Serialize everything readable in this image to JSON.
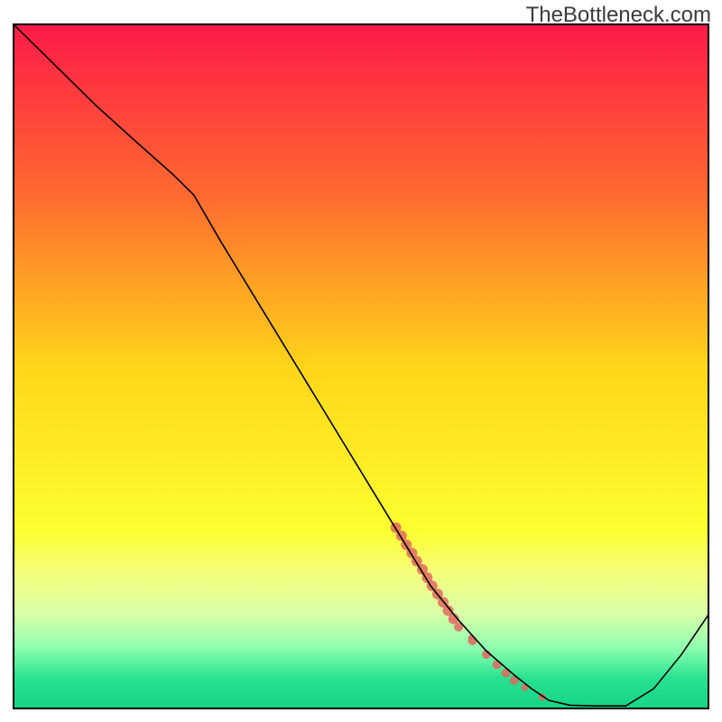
{
  "watermark_text": "TheBottleneck.com",
  "chart_data": {
    "type": "line",
    "title": "",
    "xlabel": "",
    "ylabel": "",
    "xlim": [
      0,
      100
    ],
    "ylim": [
      0,
      100
    ],
    "grid": false,
    "background_gradient_stops": [
      {
        "offset": 0.0,
        "color": "#ff1a48"
      },
      {
        "offset": 0.25,
        "color": "#ff6a30"
      },
      {
        "offset": 0.5,
        "color": "#ffd519"
      },
      {
        "offset": 0.74,
        "color": "#fcff2f"
      },
      {
        "offset": 0.8,
        "color": "#f5ff7a"
      },
      {
        "offset": 0.86,
        "color": "#d9ffa8"
      },
      {
        "offset": 0.91,
        "color": "#8effaf"
      },
      {
        "offset": 0.955,
        "color": "#27e290"
      },
      {
        "offset": 1.0,
        "color": "#14d484"
      }
    ],
    "series": [
      {
        "name": "bottleneck-curve",
        "color": "#000000",
        "width": 1.6,
        "x": [
          0,
          6,
          12,
          18,
          23,
          26,
          30,
          36,
          42,
          48,
          54,
          60,
          64,
          68,
          72,
          74.5,
          77,
          80,
          84,
          88,
          92,
          96,
          100
        ],
        "y": [
          100,
          94,
          88,
          82.5,
          78,
          75,
          68,
          58,
          48,
          38,
          28,
          18,
          13,
          8.5,
          5,
          3,
          1.3,
          0.6,
          0.5,
          0.5,
          3,
          8,
          14
        ]
      }
    ],
    "scatter_clusters": [
      {
        "name": "marker-cluster",
        "color": "#e0695f",
        "opacity": 0.85,
        "points": [
          {
            "x": 55.0,
            "y": 26.5,
            "r": 6
          },
          {
            "x": 55.8,
            "y": 25.3,
            "r": 6
          },
          {
            "x": 56.5,
            "y": 24.0,
            "r": 6
          },
          {
            "x": 57.3,
            "y": 22.8,
            "r": 6
          },
          {
            "x": 58.0,
            "y": 21.6,
            "r": 6
          },
          {
            "x": 58.8,
            "y": 20.4,
            "r": 6
          },
          {
            "x": 59.5,
            "y": 19.2,
            "r": 6
          },
          {
            "x": 60.2,
            "y": 18.0,
            "r": 6
          },
          {
            "x": 61.0,
            "y": 16.8,
            "r": 6
          },
          {
            "x": 61.8,
            "y": 15.6,
            "r": 6
          },
          {
            "x": 62.5,
            "y": 14.4,
            "r": 6
          },
          {
            "x": 63.3,
            "y": 13.2,
            "r": 6
          },
          {
            "x": 64.0,
            "y": 12.0,
            "r": 5
          },
          {
            "x": 65.8,
            "y": 10.5,
            "r": 3
          },
          {
            "x": 66.0,
            "y": 10.0,
            "r": 5
          },
          {
            "x": 68.0,
            "y": 8.0,
            "r": 5
          },
          {
            "x": 69.5,
            "y": 6.5,
            "r": 5
          },
          {
            "x": 70.8,
            "y": 5.3,
            "r": 5
          },
          {
            "x": 72.0,
            "y": 4.2,
            "r": 5
          },
          {
            "x": 73.5,
            "y": 3.2,
            "r": 4
          },
          {
            "x": 76.0,
            "y": 1.8,
            "r": 4
          }
        ]
      }
    ]
  }
}
